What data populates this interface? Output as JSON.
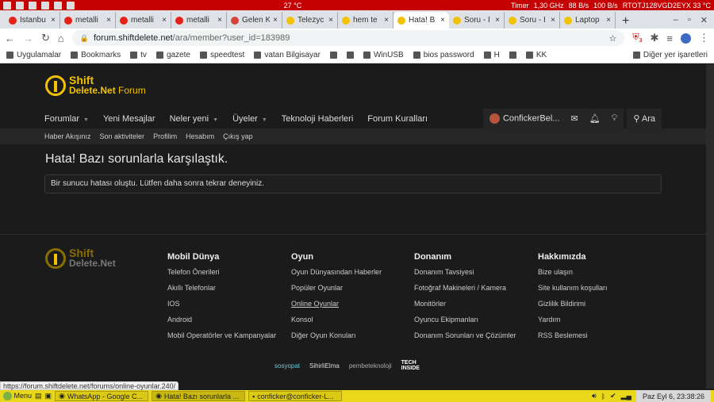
{
  "system": {
    "weather": "27 °C",
    "timer": "Timer",
    "cpu": "1,30 GHz",
    "down": "88 B/s",
    "up": "100 B/s",
    "disk": "RTOTJ128VGD2EYX 33 °C"
  },
  "tabs": [
    {
      "label": "İstanbu",
      "color": "#e62117"
    },
    {
      "label": "metalli",
      "color": "#e62117"
    },
    {
      "label": "metalli",
      "color": "#e62117"
    },
    {
      "label": "metalli",
      "color": "#e62117"
    },
    {
      "label": "Gelen K",
      "color": "#d44638"
    },
    {
      "label": "Telezyc",
      "color": "#f2c200"
    },
    {
      "label": "hem te",
      "color": "#f2c200"
    },
    {
      "label": "Hata! B",
      "color": "#f2c200",
      "active": true
    },
    {
      "label": "Soru - I",
      "color": "#f2c200"
    },
    {
      "label": "Soru - I",
      "color": "#f2c200"
    },
    {
      "label": "Laptop",
      "color": "#f2c200"
    }
  ],
  "address": {
    "domain": "forum.shiftdelete.net",
    "path": "/ara/member?user_id=183989",
    "ext_badge": "3"
  },
  "bookmarks": [
    "Uygulamalar",
    "Bookmarks",
    "tv",
    "gazete",
    "speedtest",
    "vatan Bilgisayar",
    "",
    "",
    "WinUSB",
    "bios password",
    "H",
    "",
    "KK"
  ],
  "bookmarks_other": "Diğer yer işaretleri",
  "logo": {
    "line1": "Shift",
    "line2": "Delete.Net",
    "line3": "Forum"
  },
  "nav": [
    {
      "label": "Forumlar",
      "dd": true
    },
    {
      "label": "Yeni Mesajlar"
    },
    {
      "label": "Neler yeni",
      "dd": true
    },
    {
      "label": "Üyeler",
      "dd": true
    },
    {
      "label": "Teknoloji Haberleri"
    },
    {
      "label": "Forum Kuralları"
    }
  ],
  "user": {
    "name": "ConfickerBel...",
    "search": "Ara"
  },
  "subnav": [
    "Haber Akışınız",
    "Son aktiviteler",
    "Profilim",
    "Hesabım",
    "Çıkış yap"
  ],
  "error": {
    "title": "Hata! Bazı sorunlarla karşılaştık.",
    "message": "Bir sunucu hatası oluştu. Lütfen daha sonra tekrar deneyiniz."
  },
  "footer": {
    "logo": {
      "line1": "Shift",
      "line2": "Delete.Net"
    },
    "columns": [
      {
        "title": "Mobil Dünya",
        "links": [
          "Telefon Önerileri",
          "Akıllı Telefonlar",
          "IOS",
          "Android",
          "Mobil Operatörler ve Kampanyalar"
        ]
      },
      {
        "title": "Oyun",
        "links": [
          "Oyun Dünyasından Haberler",
          "Popüler Oyunlar",
          "Online Oyunlar",
          "Konsol",
          "Diğer Oyun Konuları"
        ]
      },
      {
        "title": "Donanım",
        "links": [
          "Donanım Tavsiyesi",
          "Fotoğraf Makineleri / Kamera",
          "Monitörler",
          "Oyuncu Ekipmanları",
          "Donanım Sorunları ve Çözümler"
        ]
      },
      {
        "title": "Hakkımızda",
        "links": [
          "Bize ulaşın",
          "Site kullanım koşulları",
          "Gizlilik Bildirimi",
          "Yardım",
          "RSS Beslemesi"
        ]
      }
    ],
    "partners": [
      "sosyopat",
      "SihirliElma",
      "pembeteknoloji",
      "TECH INSIDE"
    ]
  },
  "status_url": "https://forum.shiftdelete.net/forums/online-oyunlar.240/",
  "taskbar": {
    "menu": "Menu",
    "tasks": [
      "WhatsApp - Google C...",
      "Hata! Bazı sorunlarla ...",
      "conficker@conficker-L..."
    ],
    "clock": "Paz Eyl  6, 23:38:26"
  }
}
